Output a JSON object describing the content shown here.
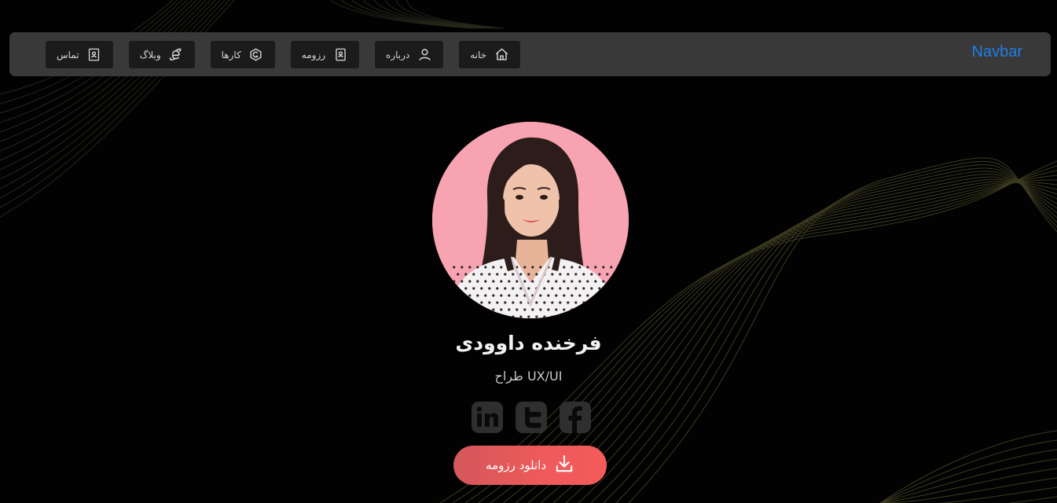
{
  "navbar": {
    "brand": "Navbar",
    "items": [
      {
        "label": "خانه",
        "icon": "home-icon"
      },
      {
        "label": "درباره",
        "icon": "user-icon"
      },
      {
        "label": "رزومه",
        "icon": "resume-icon"
      },
      {
        "label": "کارها",
        "icon": "portfolio-icon"
      },
      {
        "label": "وبلاگ",
        "icon": "blog-icon"
      },
      {
        "label": "تماس",
        "icon": "contact-icon"
      }
    ]
  },
  "profile": {
    "name": "فرخنده داوودی",
    "role": "طراح UX/UI",
    "photo": "profile-photo"
  },
  "socials": [
    {
      "name": "linkedin",
      "icon": "linkedin-icon"
    },
    {
      "name": "twitter",
      "icon": "twitter-icon"
    },
    {
      "name": "facebook",
      "icon": "facebook-icon"
    }
  ],
  "download": {
    "label": "دانلود رزومه",
    "icon": "download-icon"
  },
  "colors": {
    "background": "#020202",
    "navbar": "#393939",
    "nav_item": "#1b1b1b",
    "brand": "#1f7fe6",
    "button_start": "#d3585b",
    "button_end": "#f45b5b",
    "social": "#3a3a3a",
    "lines": "#6b6a3a"
  }
}
